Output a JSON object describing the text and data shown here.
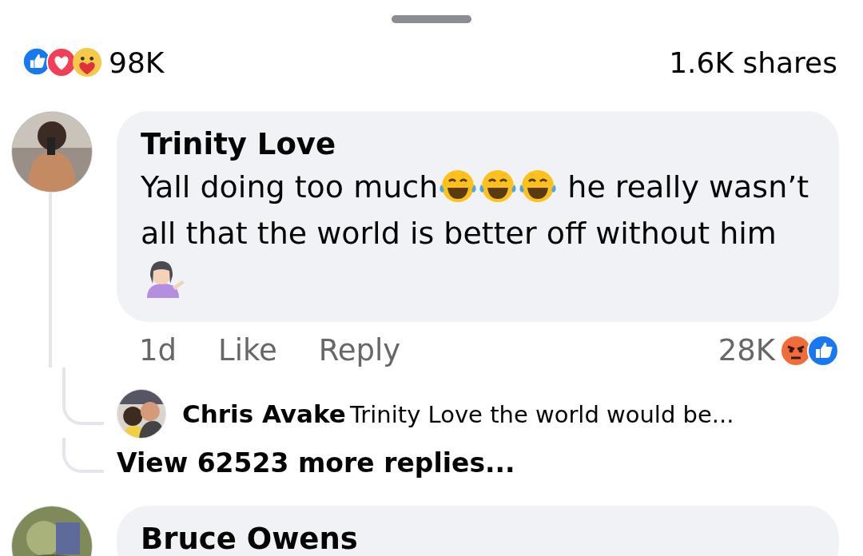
{
  "summary": {
    "reaction_count": "98K",
    "shares": "1.6K shares"
  },
  "comments": [
    {
      "author": "Trinity Love",
      "body": [
        {
          "kind": "text",
          "text": "Yall doing too much"
        },
        {
          "kind": "laugh"
        },
        {
          "kind": "laugh"
        },
        {
          "kind": "laugh"
        },
        {
          "kind": "text",
          "text": " he really wasn’t all that the world is better off without him"
        },
        {
          "kind": "shrug"
        }
      ],
      "time": "1d",
      "actions": [
        "Like",
        "Reply"
      ],
      "reaction_count": "28K",
      "replies": [
        {
          "author": "Chris Avake",
          "text": "Trinity Love the world would be..."
        }
      ],
      "more_replies": "View 62523 more replies..."
    },
    {
      "author": "Bruce Owens"
    }
  ]
}
